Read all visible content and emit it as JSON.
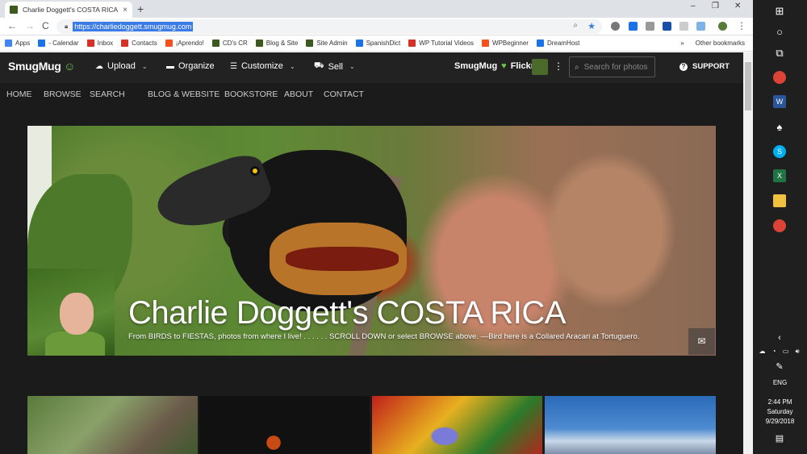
{
  "browser": {
    "tab_title": "Charlie Doggett's COSTA RICA",
    "tab_close": "×",
    "new_tab": "+",
    "url": "https://charliedoggett.smugmug.com",
    "nav": {
      "back": "←",
      "forward": "→",
      "reload": "C"
    },
    "window": {
      "minimize": "–",
      "maximize": "❐",
      "close": "✕"
    },
    "bookmarks": [
      {
        "label": "Apps",
        "color": "#4285f4"
      },
      {
        "label": "- Calendar",
        "color": "#1a73e8"
      },
      {
        "label": "Inbox",
        "color": "#d93025"
      },
      {
        "label": "Contacts",
        "color": "#d93025"
      },
      {
        "label": "¡Aprendo!",
        "color": "#f4511e"
      },
      {
        "label": "CD's CR",
        "color": "#3c5a1e"
      },
      {
        "label": "Blog & Site",
        "color": "#3c5a1e"
      },
      {
        "label": "Site Admin",
        "color": "#3c5a1e"
      },
      {
        "label": "SpanishDict",
        "color": "#1a73e8"
      },
      {
        "label": "WP Tutorial Videos",
        "color": "#d93025"
      },
      {
        "label": "WPBeginner",
        "color": "#f4511e"
      },
      {
        "label": "DreamHost",
        "color": "#1a73e8"
      }
    ],
    "more_bookmarks": "»",
    "other_bookmarks": "Other bookmarks"
  },
  "smugmug": {
    "logo": "SmugMug",
    "logo_smile": "☺",
    "nav": [
      {
        "label": "Upload",
        "icon": "☁"
      },
      {
        "label": "Organize",
        "icon": "▬"
      },
      {
        "label": "Customize",
        "icon": "☰"
      },
      {
        "label": "Sell",
        "icon": "⛟"
      }
    ],
    "chevron": "⌄",
    "partner_left": "SmugMug",
    "partner_right": "Flickr",
    "heart": "♥",
    "more": "⋮",
    "search_icon": "⌕",
    "search_placeholder": "Search for photos",
    "support": "SUPPORT",
    "support_icon": "?"
  },
  "site_nav": [
    "HOME",
    "BROWSE",
    "SEARCH",
    "BLOG & WEBSITE",
    "BOOKSTORE",
    "ABOUT",
    "CONTACT"
  ],
  "hero": {
    "title": "Charlie Doggett's COSTA RICA",
    "subtitle": "From BIRDS to FIESTAS, photos from where I live! . . . . . . SCROLL DOWN or select BROWSE above. —Bird here is a Collared Aracari at Tortuguero.",
    "mail_icon": "✉"
  },
  "taskbar": {
    "lang": "ENG",
    "time": "2:44 PM",
    "day": "Saturday",
    "date": "9/29/2018",
    "chevron": "‹",
    "notification_icon": "▤"
  }
}
